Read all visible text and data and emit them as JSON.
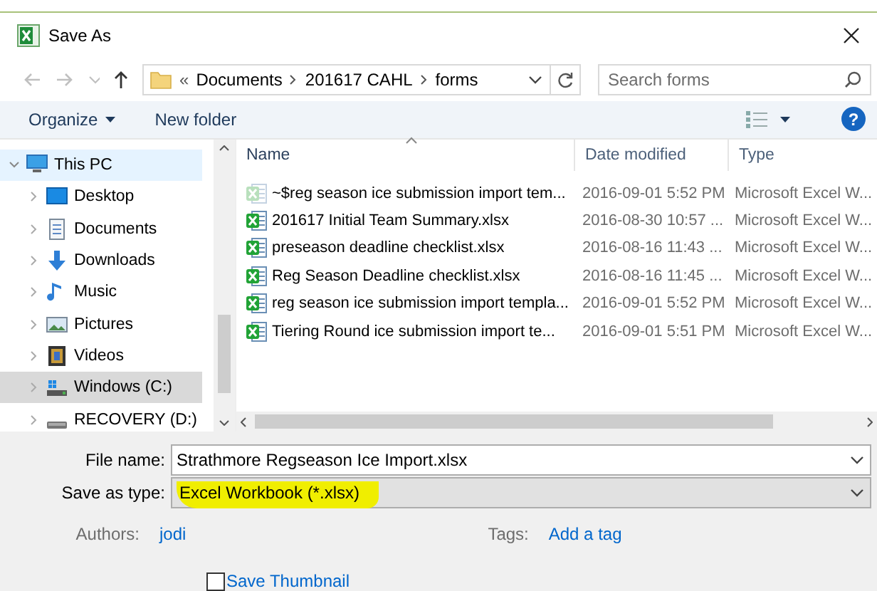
{
  "window": {
    "title": "Save As"
  },
  "nav_buttons": [
    {
      "kind": "back",
      "disabled": true
    },
    {
      "kind": "forward",
      "disabled": true
    },
    {
      "kind": "recent",
      "disabled": true
    },
    {
      "kind": "up",
      "disabled": false
    }
  ],
  "address": {
    "prefix": "«",
    "path": [
      "Documents",
      "201617 CAHL",
      "forms"
    ]
  },
  "search": {
    "placeholder": "Search forms"
  },
  "toolbar": {
    "organize": "Organize",
    "new_folder": "New folder",
    "help": "?"
  },
  "sidebar": {
    "items": [
      {
        "label": "This PC",
        "kind": "pc",
        "expanded": true,
        "selected": false,
        "hovered": true,
        "children": [
          {
            "label": "Desktop",
            "kind": "desktop",
            "expanded": false,
            "selected": false,
            "hovered": false
          },
          {
            "label": "Documents",
            "kind": "documents",
            "expanded": false,
            "selected": false,
            "hovered": false
          },
          {
            "label": "Downloads",
            "kind": "downloads",
            "expanded": false,
            "selected": false,
            "hovered": false
          },
          {
            "label": "Music",
            "kind": "music",
            "expanded": false,
            "selected": false,
            "hovered": false
          },
          {
            "label": "Pictures",
            "kind": "pictures",
            "expanded": false,
            "selected": false,
            "hovered": false
          },
          {
            "label": "Videos",
            "kind": "videos",
            "expanded": false,
            "selected": false,
            "hovered": false
          },
          {
            "label": "Windows (C:)",
            "kind": "system-drive",
            "expanded": false,
            "selected": true,
            "hovered": false
          },
          {
            "label": "RECOVERY (D:)",
            "kind": "drive",
            "expanded": false,
            "selected": false,
            "hovered": false
          }
        ]
      }
    ]
  },
  "file_list": {
    "columns": [
      {
        "label": "Name",
        "sorted": true
      },
      {
        "label": "Date modified",
        "sorted": false
      },
      {
        "label": "Type",
        "sorted": false
      }
    ],
    "rows": [
      {
        "name": "~$reg season ice submission import tem...",
        "date": "2016-09-01 5:52 PM",
        "type": "Microsoft Excel W...",
        "hidden": true
      },
      {
        "name": "201617 Initial Team Summary.xlsx",
        "date": "2016-08-30 10:57 ...",
        "type": "Microsoft Excel W...",
        "hidden": false
      },
      {
        "name": "preseason deadline checklist.xlsx",
        "date": "2016-08-16 11:43 ...",
        "type": "Microsoft Excel W...",
        "hidden": false
      },
      {
        "name": "Reg Season Deadline checklist.xlsx",
        "date": "2016-08-16 11:45 ...",
        "type": "Microsoft Excel W...",
        "hidden": false
      },
      {
        "name": "reg season ice submission import templa...",
        "date": "2016-09-01 5:52 PM",
        "type": "Microsoft Excel W...",
        "hidden": false
      },
      {
        "name": "Tiering Round ice submission import te...",
        "date": "2016-09-01 5:51 PM",
        "type": "Microsoft Excel W...",
        "hidden": false
      }
    ]
  },
  "save_panel": {
    "file_name_label": "File name:",
    "file_name": "Strathmore Regseason Ice Import.xlsx",
    "type_label": "Save as type:",
    "type_value": "Excel Workbook (*.xlsx)",
    "type_highlighted": true,
    "authors_label": "Authors:",
    "authors": "jodi",
    "tags_label": "Tags:",
    "tags_placeholder": "Add a tag",
    "thumbnail": {
      "label": "Save Thumbnail",
      "checked": false
    }
  }
}
